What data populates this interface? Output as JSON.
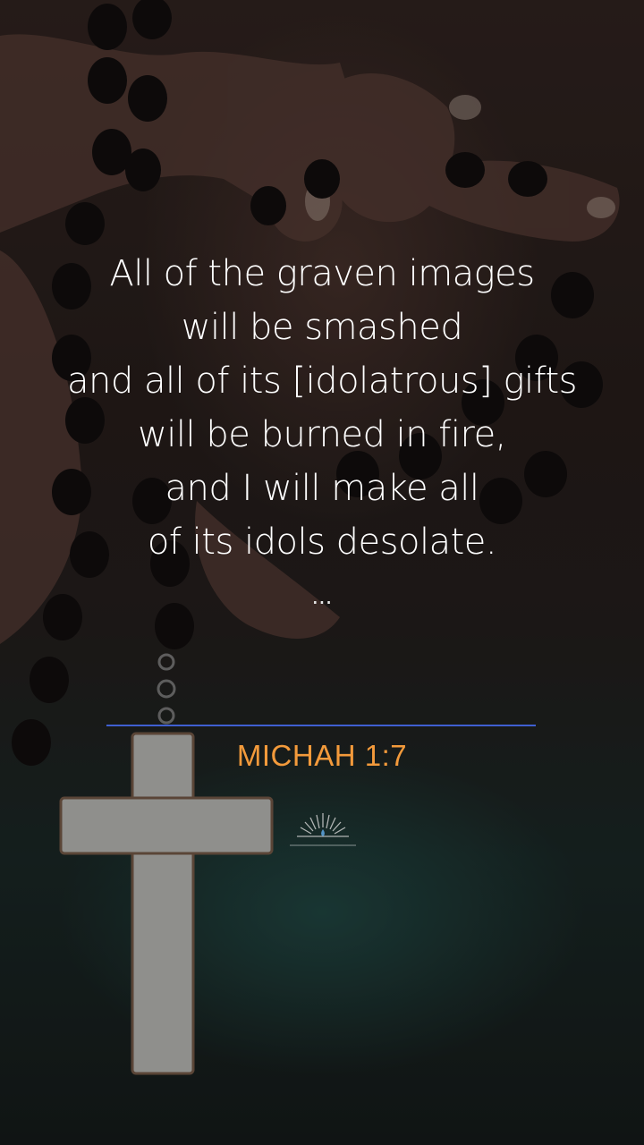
{
  "verse": {
    "lines": [
      "All of the graven images",
      "will be smashed",
      "and all of its [idolatrous] gifts",
      "will be burned in fire,",
      "and I will make all",
      "of its idols desolate."
    ],
    "ellipsis": "..."
  },
  "reference": "MICHAH 1:7",
  "logo": {
    "icon": "sunrise-candle-logo-icon"
  },
  "colors": {
    "verse_text": "#ffffff",
    "reference_text": "#f39a3b",
    "divider": "#3f5fd1"
  }
}
